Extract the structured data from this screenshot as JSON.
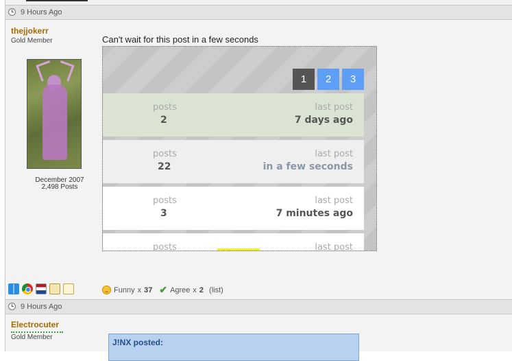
{
  "post1": {
    "timestamp": "9 Hours Ago",
    "username": "thejjokerr",
    "user_title": "Gold Member",
    "joined": "December 2007",
    "post_count": "2,498 Posts",
    "text": "Can't wait for this post in a few seconds",
    "widget": {
      "pages": [
        "1",
        "2",
        "3"
      ],
      "active_page": "1",
      "rows": [
        {
          "posts_label": "posts",
          "posts_value": "2",
          "last_label": "last post",
          "last_value": "7 days ago"
        },
        {
          "posts_label": "posts",
          "posts_value": "22",
          "last_label": "last post",
          "last_value": "in a few seconds"
        },
        {
          "posts_label": "posts",
          "posts_value": "3",
          "last_label": "last post",
          "last_value": "7 minutes ago"
        },
        {
          "posts_label": "posts",
          "posts_value": "",
          "last_label": "last post",
          "last_value": ""
        }
      ]
    },
    "reactions": {
      "funny_label": "Funny",
      "funny_x": "x",
      "funny_count": "37",
      "agree_label": "Agree",
      "agree_x": "x",
      "agree_count": "2",
      "list_link": "(list)"
    },
    "icons": [
      "windows-icon",
      "chrome-icon",
      "netherlands-flag-icon",
      "calendar-icon",
      "notepad-icon"
    ],
    "colors": {
      "username": "#a86a00",
      "page_active": "#555555",
      "page_inactive": "#5e9ef5",
      "row_highlight": "#dbe3d2"
    }
  },
  "post2": {
    "timestamp": "9 Hours Ago",
    "username": "Electrocuter",
    "user_title": "Gold Member",
    "quote_title": "J!NX posted:"
  }
}
